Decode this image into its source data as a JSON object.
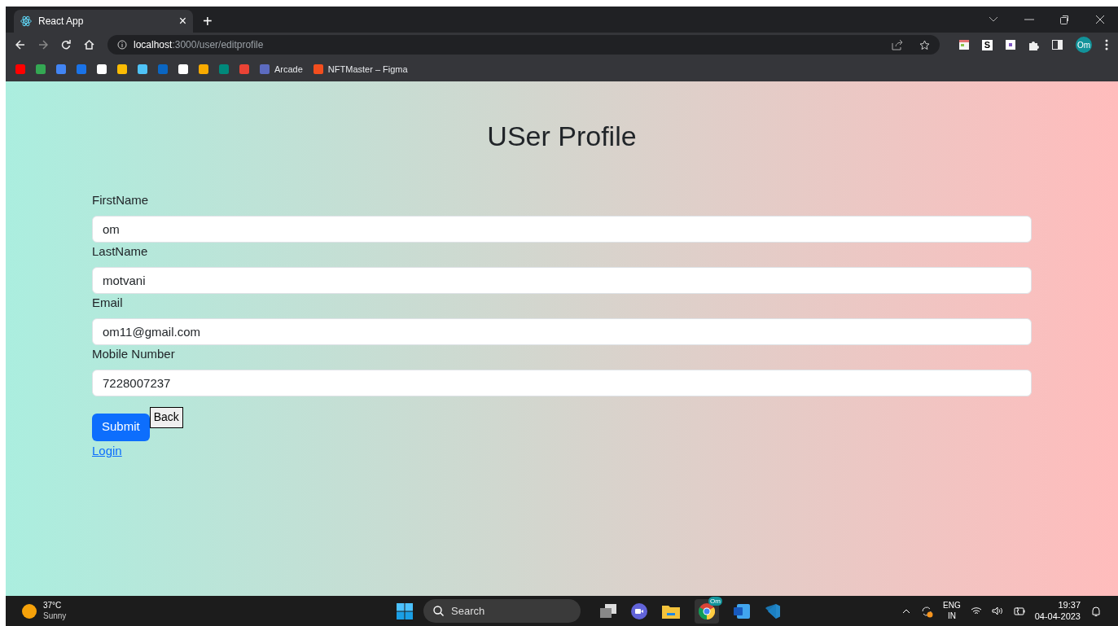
{
  "browser": {
    "tab": {
      "title": "React App",
      "close": "×",
      "selected": true
    },
    "new_tab": "+",
    "url_host": "localhost",
    "url_path": ":3000/user/editprofile",
    "profile": "Om",
    "extension_letter": "S",
    "bookmarks": [
      {
        "label": "Arcade"
      },
      {
        "label": "NFTMaster – Figma"
      }
    ]
  },
  "page": {
    "title": "USer Profile",
    "fields": [
      {
        "label": "FirstName",
        "value": "om"
      },
      {
        "label": "LastName",
        "value": "motvani"
      },
      {
        "label": "Email",
        "value": "om11@gmail.com"
      },
      {
        "label": "Mobile Number",
        "value": "7228007237"
      }
    ],
    "submit": "Submit",
    "back": "Back",
    "login_link": "Login"
  },
  "taskbar": {
    "temperature": "37°C",
    "weather": "Sunny",
    "search_placeholder": "Search",
    "chrome_badge": "Om",
    "language": "ENG",
    "region": "IN",
    "time": "19:37",
    "date": "04-04-2023"
  }
}
